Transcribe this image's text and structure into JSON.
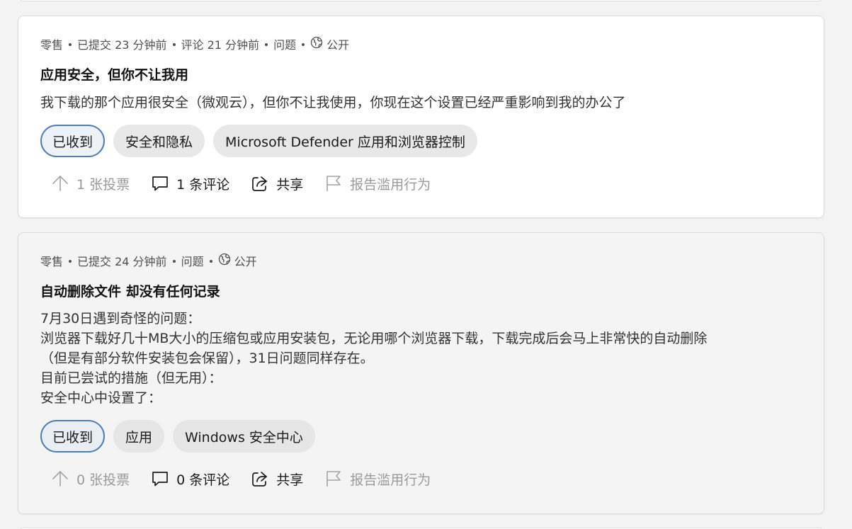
{
  "posts": [
    {
      "meta": {
        "category": "零售",
        "submitted": "已提交 23 分钟前",
        "commented": "评论 21 分钟前",
        "type": "问题",
        "visibility": "公开"
      },
      "title": "应用安全，但你不让我用",
      "body_lines": [
        "我下载的那个应用很安全（微观云），但你不让我使用，你现在这个设置已经严重影响到我的办公了"
      ],
      "status_tag": "已收到",
      "tags": [
        "安全和隐私",
        "Microsoft Defender 应用和浏览器控制"
      ],
      "actions": {
        "votes": "1 张投票",
        "comments": "1 条评论",
        "share": "共享",
        "report": "报告滥用行为"
      }
    },
    {
      "meta": {
        "category": "零售",
        "submitted": "已提交 24 分钟前",
        "type": "问题",
        "visibility": "公开"
      },
      "title": "自动删除文件 却没有任何记录",
      "body_lines": [
        "7月30日遇到奇怪的问题：",
        "浏览器下载好几十MB大小的压缩包或应用安装包，无论用哪个浏览器下载，下载完成后会马上非常快的自动删除",
        "（但是有部分软件安装包会保留），31日问题同样存在。",
        "目前已尝试的措施（但无用）：",
        "安全中心中设置了："
      ],
      "status_tag": "已收到",
      "tags": [
        "应用",
        "Windows 安全中心"
      ],
      "actions": {
        "votes": "0 张投票",
        "comments": "0 条评论",
        "share": "共享",
        "report": "报告滥用行为"
      }
    }
  ],
  "colors": {
    "status_border": "#4f7db3",
    "muted_text": "#9a9a9a",
    "meta_text": "#505050"
  },
  "icons": [
    "globe-icon",
    "arrow-up-icon",
    "comment-icon",
    "share-icon",
    "flag-icon"
  ]
}
